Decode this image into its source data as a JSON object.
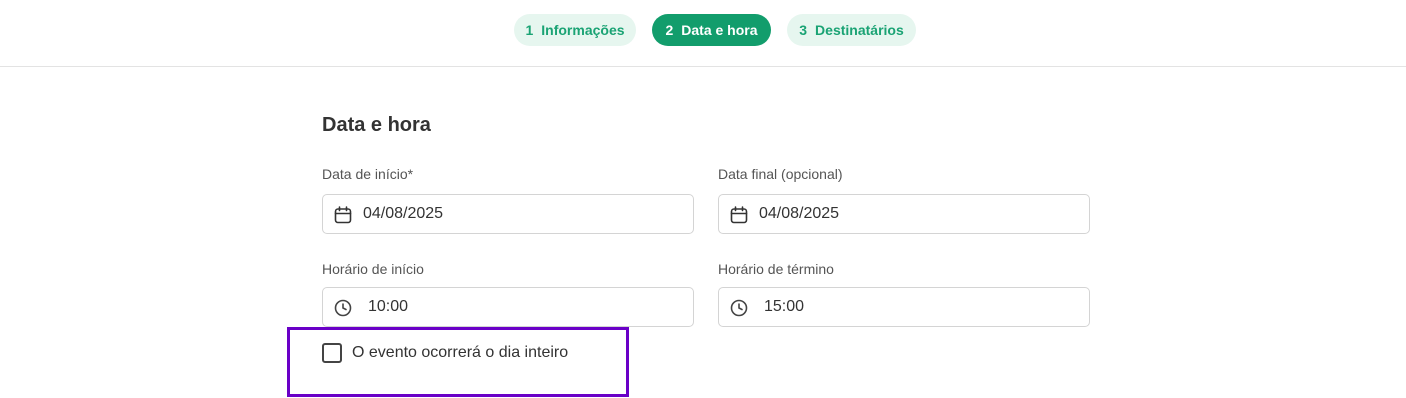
{
  "stepper": {
    "steps": [
      {
        "number": "1",
        "label": "Informações",
        "state": "inactive"
      },
      {
        "number": "2",
        "label": "Data e hora",
        "state": "active"
      },
      {
        "number": "3",
        "label": "Destinatários",
        "state": "inactive"
      }
    ]
  },
  "form": {
    "title": "Data e hora",
    "start_date": {
      "label": "Data de início*",
      "value": "04/08/2025",
      "icon": "calendar-icon"
    },
    "end_date": {
      "label": "Data final (opcional)",
      "value": "04/08/2025",
      "icon": "calendar-icon"
    },
    "start_time": {
      "label": "Horário de início",
      "value": "10:00",
      "icon": "clock-icon"
    },
    "end_time": {
      "label": "Horário de término",
      "value": "15:00",
      "icon": "clock-icon"
    },
    "all_day": {
      "label": "O evento ocorrerá o dia inteiro",
      "checked": false
    }
  },
  "colors": {
    "accent": "#129d6c",
    "accent_light": "#e6f6ef",
    "highlight": "#6a00c7"
  }
}
